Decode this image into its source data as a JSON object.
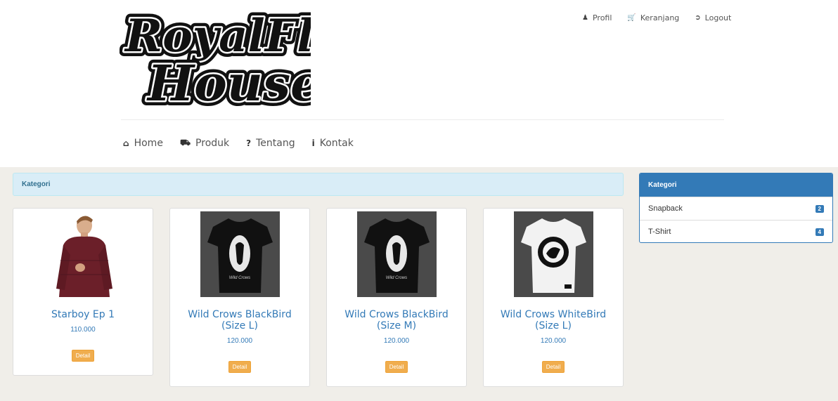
{
  "header": {
    "logo_text": "RoyalFlush House",
    "top_links": [
      {
        "label": "Profil",
        "icon": "user-icon"
      },
      {
        "label": "Keranjang",
        "icon": "cart-icon"
      },
      {
        "label": "Logout",
        "icon": "logout-icon"
      }
    ],
    "nav": [
      {
        "label": "Home",
        "icon": "home-icon"
      },
      {
        "label": "Produk",
        "icon": "truck-icon"
      },
      {
        "label": "Tentang",
        "icon": "question-icon"
      },
      {
        "label": "Kontak",
        "icon": "info-icon"
      }
    ]
  },
  "main": {
    "heading": "Kategori",
    "products": [
      {
        "name": "Starboy Ep 1",
        "price": "110.000",
        "button": "Detail"
      },
      {
        "name": "Wild Crows BlackBird (Size L)",
        "price": "120.000",
        "button": "Detail"
      },
      {
        "name": "Wild Crows BlackBird (Size M)",
        "price": "120.000",
        "button": "Detail"
      },
      {
        "name": "Wild Crows WhiteBird (Size L)",
        "price": "120.000",
        "button": "Detail"
      }
    ]
  },
  "sidebar": {
    "title": "Kategori",
    "items": [
      {
        "label": "Snapback",
        "count": "2"
      },
      {
        "label": "T-Shirt",
        "count": "4"
      }
    ]
  },
  "colors": {
    "primary": "#337ab7",
    "info_bg": "#d9edf7",
    "warning": "#f0ad4e",
    "page_bg": "#f0eee9"
  }
}
